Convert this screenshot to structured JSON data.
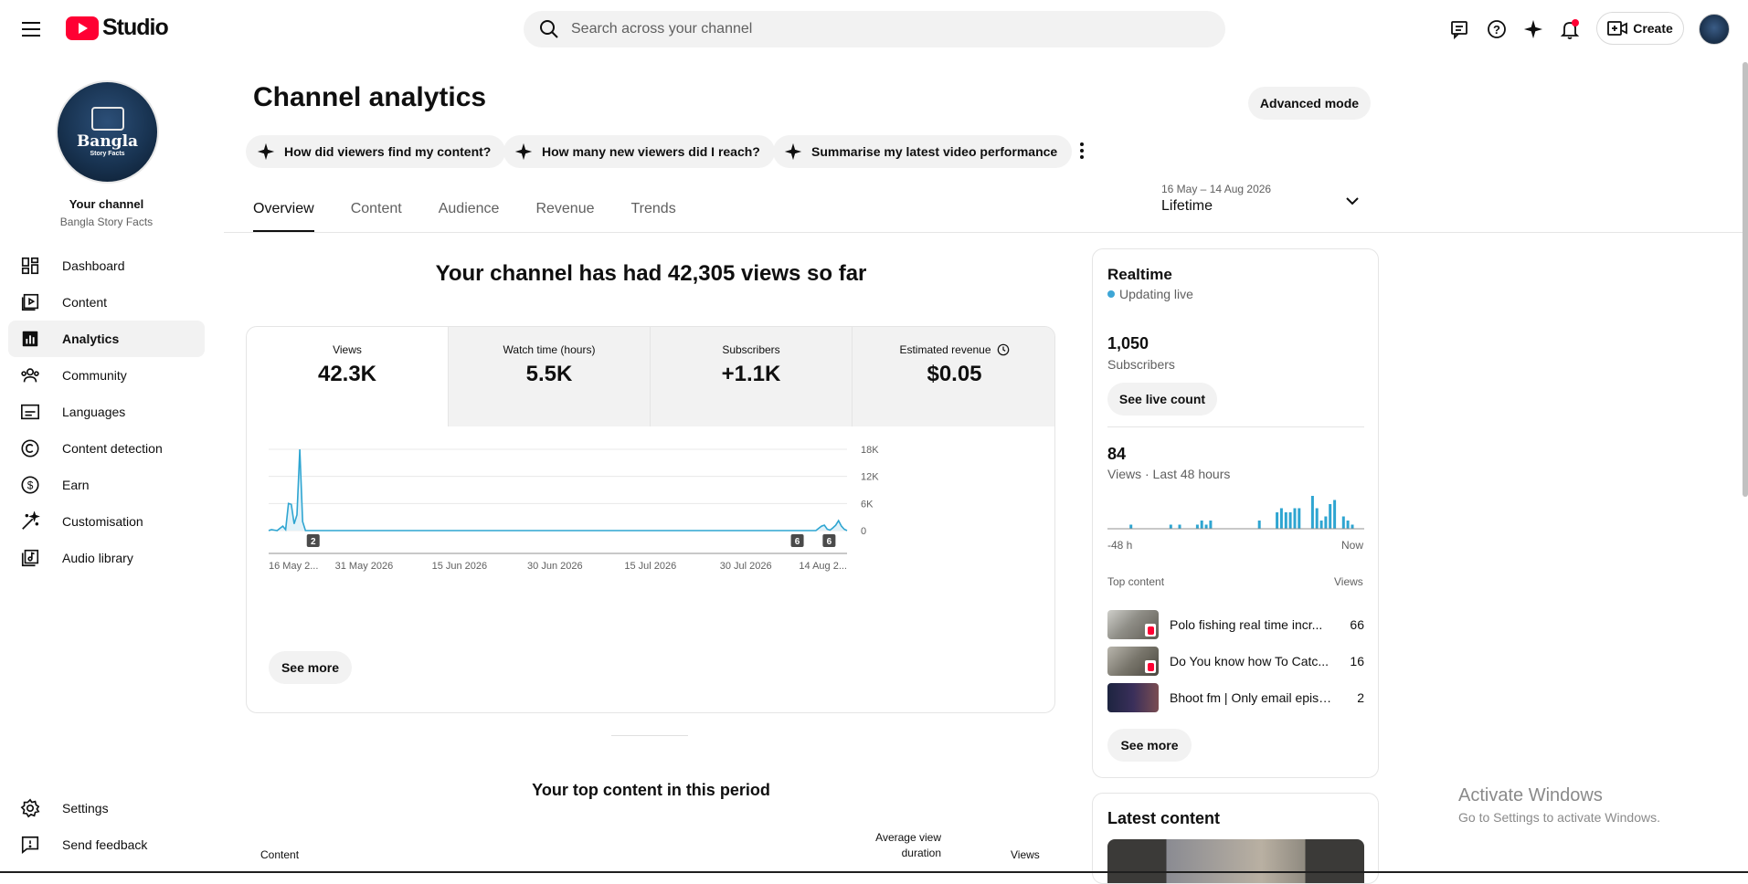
{
  "topbar": {
    "logo_text": "Studio",
    "search_placeholder": "Search across your channel",
    "create_label": "Create"
  },
  "sidebar": {
    "your_channel": "Your channel",
    "channel_name": "Bangla Story Facts",
    "avatar_text_main": "Bangla",
    "avatar_text_sub": "Story Facts",
    "items": [
      {
        "label": "Dashboard",
        "icon": "dashboard-icon"
      },
      {
        "label": "Content",
        "icon": "content-icon"
      },
      {
        "label": "Analytics",
        "icon": "analytics-icon",
        "active": true
      },
      {
        "label": "Community",
        "icon": "community-icon"
      },
      {
        "label": "Languages",
        "icon": "languages-icon"
      },
      {
        "label": "Content detection",
        "icon": "copyright-icon"
      },
      {
        "label": "Earn",
        "icon": "dollar-icon"
      },
      {
        "label": "Customisation",
        "icon": "magic-wand-icon"
      },
      {
        "label": "Audio library",
        "icon": "audio-library-icon"
      }
    ],
    "bottom_items": [
      {
        "label": "Settings",
        "icon": "gear-icon"
      },
      {
        "label": "Send feedback",
        "icon": "feedback-icon"
      }
    ]
  },
  "main": {
    "title": "Channel analytics",
    "advanced_mode": "Advanced mode",
    "chips": [
      "How did viewers find my content?",
      "How many new viewers did I reach?",
      "Summarise my latest video performance"
    ],
    "tabs": [
      "Overview",
      "Content",
      "Audience",
      "Revenue",
      "Trends"
    ],
    "active_tab": "Overview",
    "date_range": {
      "dates": "16 May – 14 Aug 2026",
      "label": "Lifetime"
    },
    "headline": "Your channel has had 42,305 views so far",
    "metrics": [
      {
        "label": "Views",
        "value": "42.3K",
        "active": true
      },
      {
        "label": "Watch time (hours)",
        "value": "5.5K"
      },
      {
        "label": "Subscribers",
        "value": "+1.1K"
      },
      {
        "label": "Estimated revenue",
        "value": "$0.05",
        "has_info_icon": true
      }
    ],
    "see_more": "See more",
    "top_content_title": "Your top content in this period",
    "table_headers": {
      "content": "Content",
      "avg_duration_line1": "Average view",
      "avg_duration_line2": "duration",
      "views": "Views"
    }
  },
  "chart_data": {
    "type": "line",
    "series": [
      {
        "values": [
          0,
          200,
          100,
          0,
          500,
          1000,
          200,
          6000,
          5800,
          1500,
          3500,
          18000,
          2000,
          0,
          0,
          0,
          0,
          0,
          0,
          0,
          0,
          0,
          0,
          0,
          0,
          0,
          0,
          0,
          0,
          0,
          0,
          0,
          0,
          0,
          0,
          0,
          0,
          0,
          0,
          0,
          0,
          0,
          0,
          0,
          0,
          0,
          0,
          0,
          0,
          0,
          0,
          0,
          0,
          0,
          0,
          0,
          0,
          0,
          0,
          0,
          0,
          0,
          0,
          0,
          0,
          0,
          0,
          0,
          0,
          0,
          0,
          0,
          0,
          0,
          0,
          0,
          0,
          0,
          0,
          0,
          0,
          0,
          0,
          0,
          0,
          0,
          0,
          0,
          0,
          0,
          0,
          0,
          0,
          0,
          0,
          0,
          0,
          0,
          0,
          0,
          0,
          0,
          0,
          0,
          0,
          0,
          0,
          0,
          0,
          0,
          0,
          0,
          0,
          0,
          0,
          0,
          0,
          0,
          0,
          0,
          0,
          0,
          0,
          0,
          0,
          0,
          0,
          0,
          0,
          0,
          0,
          0,
          0,
          0,
          0,
          0,
          0,
          0,
          0,
          0,
          0,
          0,
          0,
          0,
          0,
          0,
          0,
          0,
          0,
          0,
          0,
          0,
          0,
          0,
          0,
          0,
          0,
          0,
          0,
          0,
          0,
          0,
          0,
          0,
          0,
          0,
          0,
          0,
          0,
          0,
          0,
          0,
          0,
          0,
          0,
          0,
          0,
          0,
          0,
          0,
          0,
          0,
          0,
          0,
          0,
          0,
          0,
          0,
          0,
          0,
          0,
          0,
          0,
          0,
          500,
          1000,
          1200,
          300,
          100,
          600,
          1200,
          2200,
          1000,
          300,
          0
        ]
      }
    ],
    "x_tick_labels": [
      "16 May 2...",
      "31 May 2026",
      "15 Jun 2026",
      "30 Jun 2026",
      "15 Jul 2026",
      "30 Jul 2026",
      "14 Aug 2..."
    ],
    "y_tick_labels": [
      "18K",
      "12K",
      "6K",
      "0"
    ],
    "ylim": [
      0,
      18000
    ],
    "markers": [
      "2",
      "6",
      "6"
    ],
    "colors": {
      "line": "#2ea5d1",
      "fill": "#e2f2f9",
      "grid": "#e8e8e8"
    }
  },
  "realtime": {
    "title": "Realtime",
    "status": "Updating live",
    "subscribers_count": "1,050",
    "subscribers_label": "Subscribers",
    "see_live_count": "See live count",
    "views_count": "84",
    "views_label": "Views · Last 48 hours",
    "axis_start": "-48 h",
    "axis_end": "Now",
    "bars": [
      0,
      0,
      0,
      0,
      0,
      1,
      0,
      0,
      0,
      0,
      0,
      0,
      0,
      0,
      1,
      0,
      1,
      0,
      0,
      0,
      1,
      2,
      1,
      2,
      0,
      0,
      0,
      0,
      0,
      0,
      0,
      0,
      0,
      0,
      2,
      0,
      0,
      0,
      4,
      5,
      4,
      4,
      5,
      5,
      0,
      0,
      8,
      5,
      2,
      3,
      6,
      7,
      0,
      3,
      2,
      1,
      0,
      0
    ],
    "top_content_label": "Top content",
    "views_col": "Views",
    "rows": [
      {
        "title": "Polo fishing real time incr...",
        "views": "66"
      },
      {
        "title": "Do You know how To Catc...",
        "views": "16"
      },
      {
        "title": "Bhoot fm | Only email episo...",
        "views": "2"
      }
    ],
    "see_more": "See more"
  },
  "latest": {
    "title": "Latest content"
  },
  "watermark": {
    "line1": "Activate Windows",
    "line2": "Go to Settings to activate Windows."
  }
}
